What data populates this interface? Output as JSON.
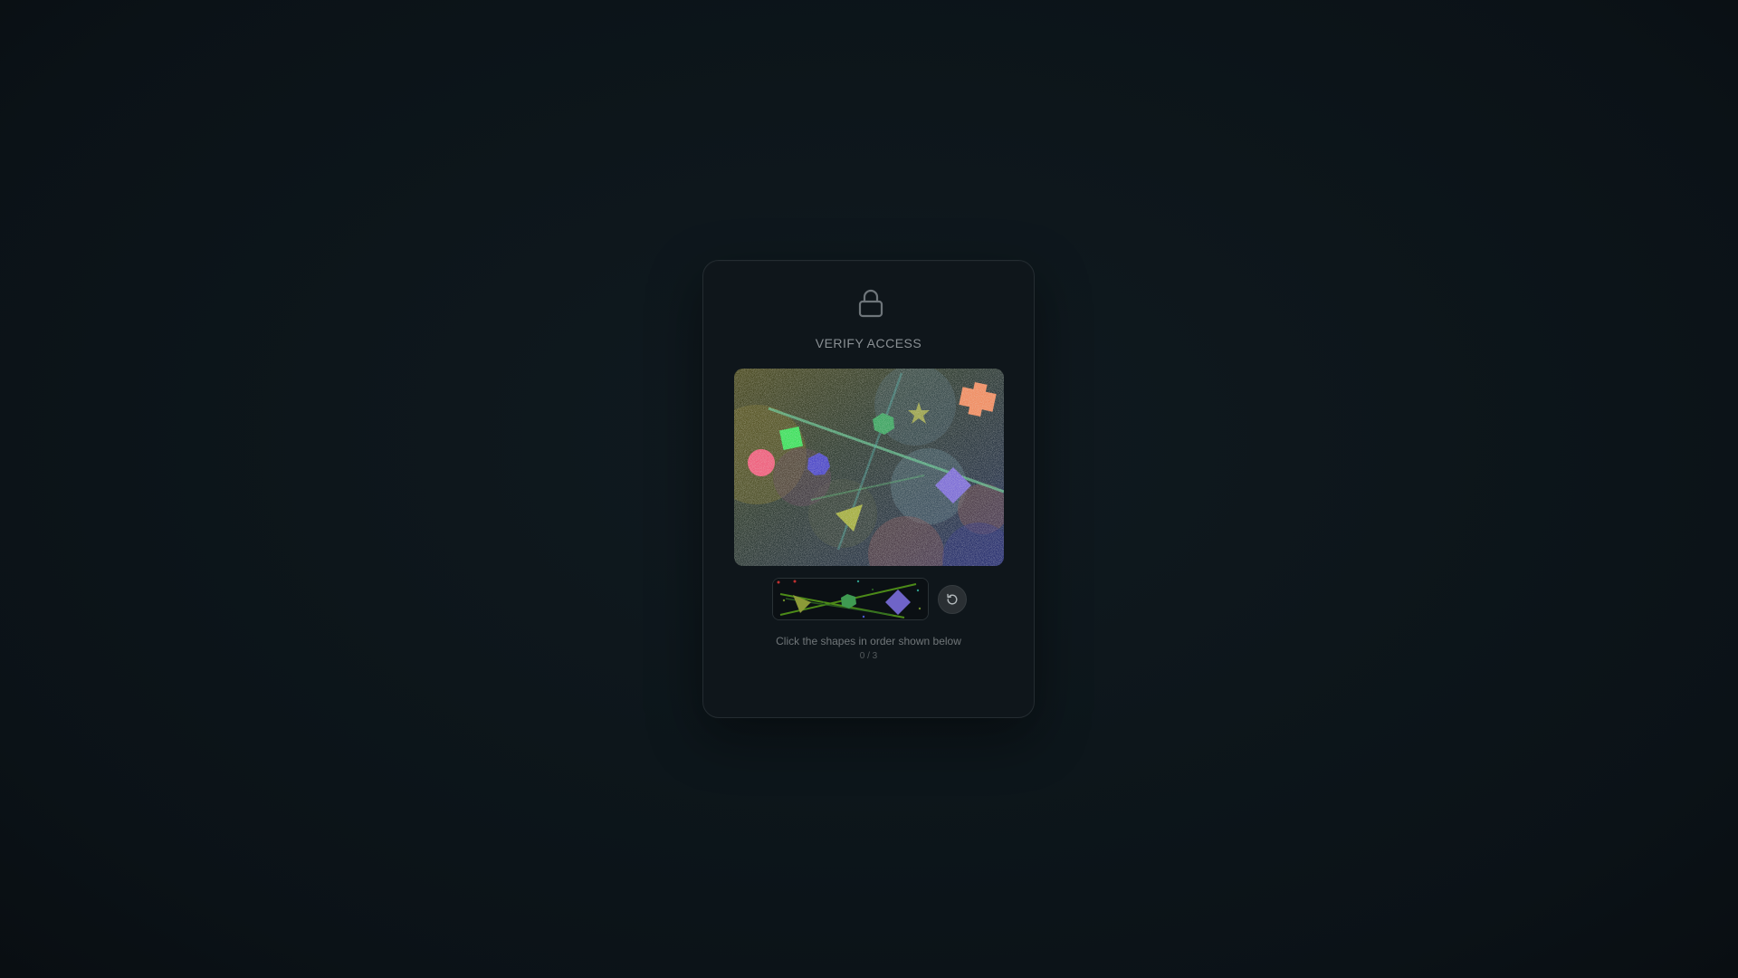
{
  "card": {
    "title": "VERIFY ACCESS",
    "lock_icon": "lock-icon",
    "instruction": "Click the shapes in order shown below",
    "progress": "0 / 3",
    "refresh_icon": "refresh-icon"
  },
  "captcha": {
    "shapes": [
      "circle",
      "square",
      "heptagon",
      "hexagon",
      "star",
      "cross",
      "diamond",
      "triangle"
    ],
    "hint_sequence": [
      "triangle",
      "hexagon",
      "diamond"
    ]
  },
  "colors": {
    "page_bg": "#0d161b",
    "card_bg": "#0f161b",
    "title": "#8a9094",
    "instruction": "#707679",
    "progress": "#555b5e"
  }
}
